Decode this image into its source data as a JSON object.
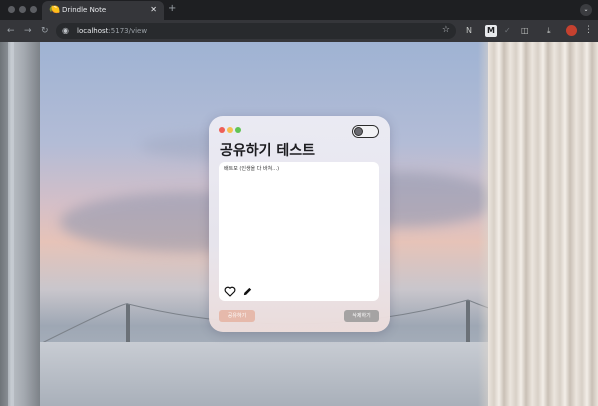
{
  "browser": {
    "tab_title": "Drindle Note",
    "tab_favicon": "🍋",
    "tab_close": "✕",
    "new_tab": "+",
    "url_host": "localhost",
    "url_path": ":5173/view",
    "icons": [
      "back-icon",
      "forward-icon",
      "reload-icon",
      "site-info-icon",
      "bookmark-star-icon",
      "extension-icons",
      "download-icon",
      "profile-avatar",
      "more-menu-icon"
    ]
  },
  "card": {
    "title": "공유하기 테스트",
    "body": "배트모 (인생을 다 바쳐…)",
    "share_label": "공유하기",
    "delete_label": "삭제하기",
    "window_dots": [
      "#ee5f57",
      "#f5bf4f",
      "#61c454"
    ]
  },
  "colors": {
    "share_button": "#e6b9ab",
    "delete_button": "#a5a3a3",
    "profile": "#c5412f"
  }
}
